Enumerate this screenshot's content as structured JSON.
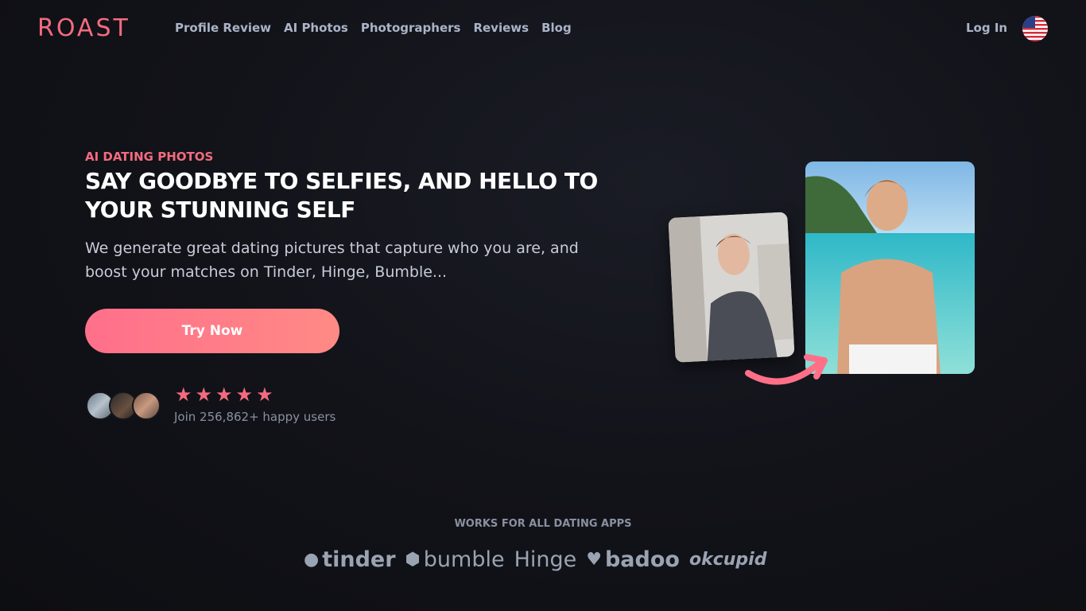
{
  "brand": "ROAST",
  "nav": {
    "items": [
      "Profile Review",
      "AI Photos",
      "Photographers",
      "Reviews",
      "Blog"
    ],
    "login": "Log In"
  },
  "hero": {
    "eyebrow": "AI DATING PHOTOS",
    "headline": "SAY GOODBYE TO SELFIES, AND HELLO TO YOUR STUNNING SELF",
    "subtitle": "We generate great dating pictures that capture who you are, and boost your matches on Tinder, Hinge, Bumble...",
    "cta": "Try Now",
    "stars": 5,
    "social_proof": "Join 256,862+ happy users"
  },
  "works": {
    "title": "WORKS FOR ALL DATING APPS",
    "apps": [
      "tinder",
      "bumble",
      "Hinge",
      "badoo",
      "okcupid"
    ]
  },
  "colors": {
    "accent": "#f36b7f",
    "bg": "#121319"
  }
}
